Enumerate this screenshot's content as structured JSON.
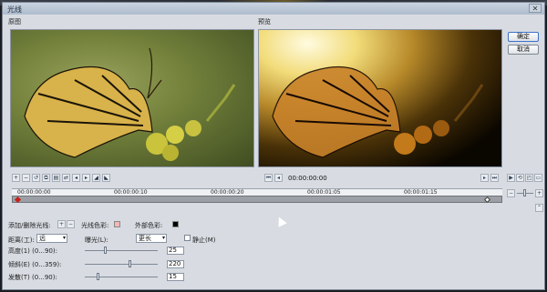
{
  "window": {
    "title": "光线"
  },
  "buttons": {
    "ok": "确定",
    "cancel": "取消"
  },
  "panels": {
    "original": "原图",
    "preview": "预览"
  },
  "timecode": "00:00:00:00",
  "ruler": {
    "labels": [
      "00:00:00:00",
      "00:00:00:10",
      "00:00:00:20",
      "00:00:01:05",
      "00:00:01:15"
    ]
  },
  "controls": {
    "add_remove_light": "添加/删除光线:",
    "light_color": "光线色彩:",
    "light_color_value": "#f2b7b7",
    "outer_color": "外部色彩:",
    "outer_color_value": "#000000",
    "distance_label": "距离(工):",
    "distance_value": "远",
    "exposure_label": "曝光(L):",
    "exposure_value": "更长",
    "still_label": "静止(M)",
    "height_label": "高度(1) (0...90):",
    "height_value": "25",
    "tilt_label": "倾斜(E) (0...359):",
    "tilt_value": "220",
    "spread_label": "发散(T) (0...90):",
    "spread_value": "15"
  }
}
